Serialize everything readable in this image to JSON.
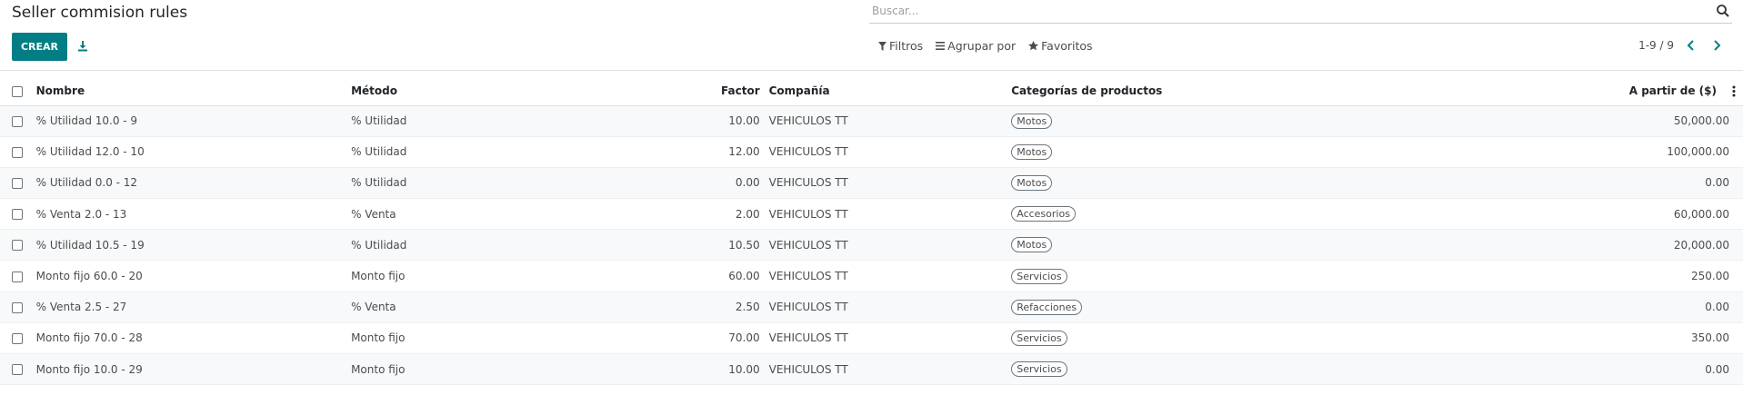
{
  "header": {
    "title": "Seller commision rules",
    "create_label": "CREAR",
    "search_placeholder": "Buscar...",
    "filters_label": "Filtros",
    "groupby_label": "Agrupar por",
    "favorites_label": "Favoritos",
    "pager": "1-9 / 9"
  },
  "columns": {
    "name": "Nombre",
    "method": "Método",
    "factor": "Factor",
    "company": "Compañía",
    "categories": "Categorías de productos",
    "amount": "A partir de ($)"
  },
  "rows": [
    {
      "name": "% Utilidad 10.0 - 9",
      "method": "% Utilidad",
      "factor": "10.00",
      "company": "VEHICULOS TT",
      "category": "Motos",
      "amount": "50,000.00"
    },
    {
      "name": "% Utilidad 12.0 - 10",
      "method": "% Utilidad",
      "factor": "12.00",
      "company": "VEHICULOS TT",
      "category": "Motos",
      "amount": "100,000.00"
    },
    {
      "name": "% Utilidad 0.0 - 12",
      "method": "% Utilidad",
      "factor": "0.00",
      "company": "VEHICULOS TT",
      "category": "Motos",
      "amount": "0.00"
    },
    {
      "name": "% Venta 2.0 - 13",
      "method": "% Venta",
      "factor": "2.00",
      "company": "VEHICULOS TT",
      "category": "Accesorios",
      "amount": "60,000.00"
    },
    {
      "name": "% Utilidad 10.5 - 19",
      "method": "% Utilidad",
      "factor": "10.50",
      "company": "VEHICULOS TT",
      "category": "Motos",
      "amount": "20,000.00"
    },
    {
      "name": "Monto fijo 60.0 - 20",
      "method": "Monto fijo",
      "factor": "60.00",
      "company": "VEHICULOS TT",
      "category": "Servicios",
      "amount": "250.00"
    },
    {
      "name": "% Venta 2.5 - 27",
      "method": "% Venta",
      "factor": "2.50",
      "company": "VEHICULOS TT",
      "category": "Refacciones",
      "amount": "0.00"
    },
    {
      "name": "Monto fijo 70.0 - 28",
      "method": "Monto fijo",
      "factor": "70.00",
      "company": "VEHICULOS TT",
      "category": "Servicios",
      "amount": "350.00"
    },
    {
      "name": "Monto fijo 10.0 - 29",
      "method": "Monto fijo",
      "factor": "10.00",
      "company": "VEHICULOS TT",
      "category": "Servicios",
      "amount": "0.00"
    }
  ],
  "colors": {
    "primary": "#017e84"
  }
}
